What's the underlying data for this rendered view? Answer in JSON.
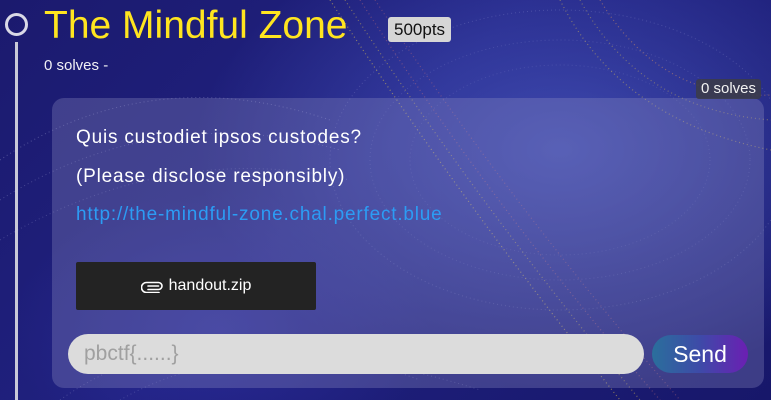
{
  "challenge": {
    "title": "The Mindful Zone",
    "points": "500pts",
    "meta": "0 solves -",
    "solves_badge": "0 solves",
    "description": [
      "Quis custodiet ipsos custodes?",
      "(Please disclose responsibly)"
    ],
    "link": "http://the-mindful-zone.chal.perfect.blue",
    "file": {
      "name": "handout.zip",
      "icon": "paperclip-icon"
    },
    "flag_input": {
      "placeholder": "pbctf{......}",
      "value": ""
    },
    "send_label": "Send"
  },
  "colors": {
    "title": "#ffe51f",
    "link": "#2c9cf4",
    "background": "#1d1d75",
    "send_gradient": [
      "#2a6f9c",
      "#6b1fb3"
    ]
  }
}
